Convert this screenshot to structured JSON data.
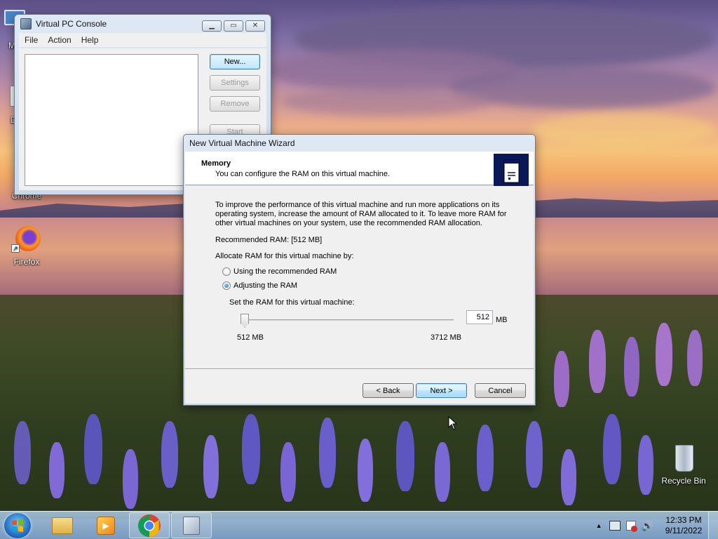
{
  "desktop": {
    "icons": [
      {
        "label": "My"
      },
      {
        "label": "Dat"
      },
      {
        "label": "Chrome"
      },
      {
        "label": "Firefox"
      },
      {
        "label": "Recycle Bin"
      }
    ]
  },
  "console_window": {
    "title": "Virtual PC Console",
    "menu": [
      "File",
      "Action",
      "Help"
    ],
    "buttons": {
      "new": "New...",
      "settings": "Settings",
      "remove": "Remove",
      "start": "Start"
    }
  },
  "wizard": {
    "title": "New Virtual Machine Wizard",
    "header_title": "Memory",
    "header_subtitle": "You can configure the RAM on this virtual machine.",
    "description": "To improve the performance of this virtual machine and run more applications on its operating system, increase the amount of RAM allocated to it. To leave more RAM for other virtual machines on your system, use the recommended RAM allocation.",
    "recommended": "Recommended RAM: [512 MB]",
    "allocate_label": "Allocate RAM for this virtual machine by:",
    "options": {
      "recommended": "Using the recommended RAM",
      "adjusting": "Adjusting the RAM",
      "selected": "adjusting"
    },
    "set_label": "Set the RAM for this virtual machine:",
    "ram_value": "512",
    "ram_unit": "MB",
    "slider": {
      "min_label": "512 MB",
      "max_label": "3712 MB",
      "value_fraction": 0.0
    },
    "buttons": {
      "back": "< Back",
      "next": "Next >",
      "cancel": "Cancel"
    }
  },
  "taskbar": {
    "items": [
      "windows-explorer",
      "media-player",
      "chrome",
      "virtual-pc"
    ],
    "clock_time": "12:33 PM",
    "clock_date": "9/11/2022"
  }
}
